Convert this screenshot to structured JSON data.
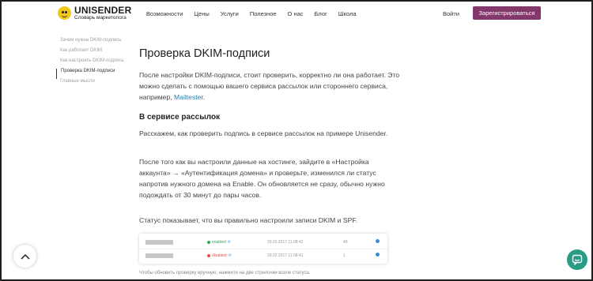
{
  "header": {
    "logo_name": "UNISENDER",
    "logo_sub": "Словарь маркетолога",
    "nav": [
      "Возможности",
      "Цены",
      "Услуги",
      "Полезное",
      "О нас",
      "Блог",
      "Школа"
    ],
    "login_label": "Войти",
    "signup_label": "Зарегистрироваться"
  },
  "toc": {
    "items": [
      "Зачем нужна DKIM-подпись",
      "Как работает DKIM",
      "Как настроить DKIM-подпись",
      "Проверка DKIM-подписи",
      "Главные мысли"
    ],
    "active_index": 3
  },
  "article": {
    "title": "Проверка DKIM-подписи",
    "intro_text": "После настройки DKIM-подписи, стоит проверить, корректно ли она работает. Это можно сделать с помощью вашего сервиса рассылок или стороннего сервиса, например, ",
    "intro_link": "Mailtester",
    "intro_end": ".",
    "section_title": "В сервисе рассылок",
    "p2": "Расскажем, как проверить подпись в сервисе рассылок на примере Unisender.",
    "p3": "После того как вы настроили данные на хостинге, зайдите в «Настройка аккаунта» → «Аутентификация домена» и проверьте, изменился ли статус напротив нужного домена на Enable. Он обновляется не сразу, обычно нужно подождать от 30 минут до пары часов.",
    "p4": "Статус показывает, что вы правильно настроили записи DKIM и SPF.",
    "caption": "Чтобы обновить проверку вручную, нажмите на две стрелочки возле статуса."
  },
  "table": {
    "rows": [
      {
        "status": "enabled",
        "status_color": "#3aa655",
        "date": "20.02.2017 11:08:42",
        "num": "49"
      },
      {
        "status": "disabled",
        "status_color": "#e05353",
        "date": "20.02.2017 11:08:41",
        "num": "1"
      }
    ]
  },
  "icons": {
    "back_to_top": "chevron-up-icon",
    "chat": "chat-icon"
  },
  "colors": {
    "accent": "#83376b",
    "link": "#2a7ea9",
    "chat": "#2a9b86"
  }
}
